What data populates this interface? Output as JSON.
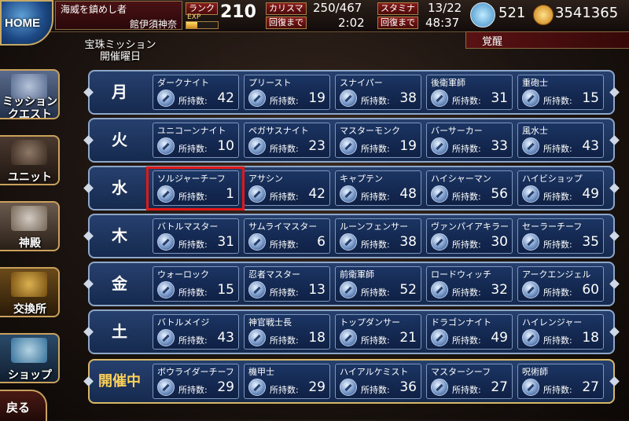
{
  "header": {
    "home_label": "HOME",
    "player_title": "海威を鎮めし者",
    "player_name": "館伊須神奈",
    "rank_label": "ランク",
    "exp_label": "EXP",
    "exp_progress": 0.35,
    "rank_value": "210",
    "charisma_label": "カリスマ",
    "charisma_value": "250/467",
    "charisma_recover_label": "回復まで",
    "charisma_recover_time": "2:02",
    "stamina_label": "スタミナ",
    "stamina_value": "13/22",
    "stamina_recover_label": "回復まで",
    "stamina_recover_time": "48:37",
    "gems": "521",
    "gold": "3541365",
    "awaken_label": "覚醒"
  },
  "sidebar": {
    "items": [
      {
        "label": "ミッション\nクエスト",
        "icon": "mission-icon"
      },
      {
        "label": "ユニット",
        "icon": "unit-icon"
      },
      {
        "label": "神殿",
        "icon": "temple-icon"
      },
      {
        "label": "交換所",
        "icon": "exchange-icon"
      },
      {
        "label": "ショップ",
        "icon": "shop-icon"
      }
    ],
    "back_label": "戻る"
  },
  "mission_header": {
    "line1": "宝珠ミッション",
    "line2": "開催曜日"
  },
  "held_label": "所持数:",
  "colors": {
    "row_bg": "#1e355f",
    "row_border": "#8ea6c8",
    "active_border": "#d7b867",
    "highlight": "#e01818"
  },
  "days": [
    {
      "day": "月",
      "classes": [
        {
          "name": "ダークナイト",
          "count": "42"
        },
        {
          "name": "プリースト",
          "count": "19"
        },
        {
          "name": "スナイパー",
          "count": "38"
        },
        {
          "name": "後衛軍師",
          "count": "31"
        },
        {
          "name": "重砲士",
          "count": "15"
        }
      ]
    },
    {
      "day": "火",
      "classes": [
        {
          "name": "ユニコーンナイト",
          "count": "10"
        },
        {
          "name": "ペガサスナイト",
          "count": "23"
        },
        {
          "name": "マスターモンク",
          "count": "19"
        },
        {
          "name": "バーサーカー",
          "count": "33"
        },
        {
          "name": "風水士",
          "count": "43"
        }
      ]
    },
    {
      "day": "水",
      "classes": [
        {
          "name": "ソルジャーチーフ",
          "count": "1"
        },
        {
          "name": "アサシン",
          "count": "42"
        },
        {
          "name": "キャプテン",
          "count": "48"
        },
        {
          "name": "ハイシャーマン",
          "count": "56"
        },
        {
          "name": "ハイビショップ",
          "count": "49"
        }
      ]
    },
    {
      "day": "木",
      "classes": [
        {
          "name": "バトルマスター",
          "count": "31"
        },
        {
          "name": "サムライマスター",
          "count": "6"
        },
        {
          "name": "ルーンフェンサー",
          "count": "38"
        },
        {
          "name": "ヴァンパイアキラー",
          "count": "30"
        },
        {
          "name": "セーラーチーフ",
          "count": "35"
        }
      ]
    },
    {
      "day": "金",
      "classes": [
        {
          "name": "ウォーロック",
          "count": "15"
        },
        {
          "name": "忍者マスター",
          "count": "13"
        },
        {
          "name": "前衛軍師",
          "count": "52"
        },
        {
          "name": "ロードウィッチ",
          "count": "32"
        },
        {
          "name": "アークエンジェル",
          "count": "60"
        }
      ]
    },
    {
      "day": "土",
      "classes": [
        {
          "name": "バトルメイジ",
          "count": "43"
        },
        {
          "name": "神官戦士長",
          "count": "18"
        },
        {
          "name": "トップダンサー",
          "count": "21"
        },
        {
          "name": "ドラゴンナイト",
          "count": "49"
        },
        {
          "name": "ハイレンジャー",
          "count": "18"
        }
      ]
    },
    {
      "day": "開催中",
      "active": true,
      "classes": [
        {
          "name": "ボウライダーチーフ",
          "count": "29"
        },
        {
          "name": "機甲士",
          "count": "29"
        },
        {
          "name": "ハイアルケミスト",
          "count": "36"
        },
        {
          "name": "マスターシーフ",
          "count": "27"
        },
        {
          "name": "呪術師",
          "count": "27"
        }
      ]
    }
  ]
}
